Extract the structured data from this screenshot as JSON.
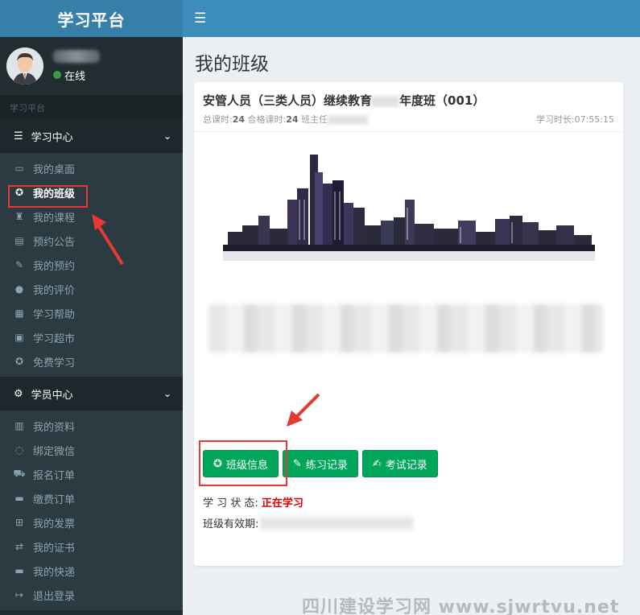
{
  "brand": "学习平台",
  "user": {
    "status": "在线"
  },
  "nav_header": "学习平台",
  "sections": [
    {
      "title": "学习中心",
      "items": [
        {
          "label": "我的桌面",
          "icon": "monitor-icon"
        },
        {
          "label": "我的班级",
          "icon": "circle-star-icon",
          "active": true
        },
        {
          "label": "我的课程",
          "icon": "graduation-cap-icon"
        },
        {
          "label": "预约公告",
          "icon": "document-icon"
        },
        {
          "label": "我的预约",
          "icon": "edit-icon"
        },
        {
          "label": "我的评价",
          "icon": "chat-icon"
        },
        {
          "label": "学习帮助",
          "icon": "book-icon"
        },
        {
          "label": "学习超市",
          "icon": "store-icon"
        },
        {
          "label": "免费学习",
          "icon": "circle-star-icon"
        }
      ]
    },
    {
      "title": "学员中心",
      "items": [
        {
          "label": "我的资料",
          "icon": "id-card-icon"
        },
        {
          "label": "绑定微信",
          "icon": "wechat-icon"
        },
        {
          "label": "报名订单",
          "icon": "cart-icon"
        },
        {
          "label": "缴费订单",
          "icon": "truck-icon"
        },
        {
          "label": "我的发票",
          "icon": "sitemap-icon"
        },
        {
          "label": "我的证书",
          "icon": "retweet-icon"
        },
        {
          "label": "我的快递",
          "icon": "truck-icon"
        },
        {
          "label": "退出登录",
          "icon": "sign-out-icon"
        }
      ]
    }
  ],
  "page_title": "我的班级",
  "class_card": {
    "title_prefix": "安管人员（三类人员）继续教育",
    "title_suffix": "年度班（001）",
    "total_hours_label": "总课时:",
    "total_hours": "24",
    "pass_hours_label": "合格课时:",
    "pass_hours": "24",
    "teacher_label": "班主任",
    "study_time_label": "学习时长:",
    "study_time": "07:55:15",
    "buttons": {
      "class_info": "班级信息",
      "practice_record": "练习记录",
      "exam_record": "考试记录"
    },
    "status_label": "学 习 状 态: ",
    "status_value": "正在学习",
    "validity_label": "班级有效期:"
  },
  "watermark": "四川建设学习网 www.sjwrtvu.net",
  "colors": {
    "sidebar": "#222d32",
    "header": "#3c8dbc",
    "brand": "#367fa9",
    "button": "#00a65a",
    "highlight": "#e53935",
    "status": "#dd0000"
  }
}
